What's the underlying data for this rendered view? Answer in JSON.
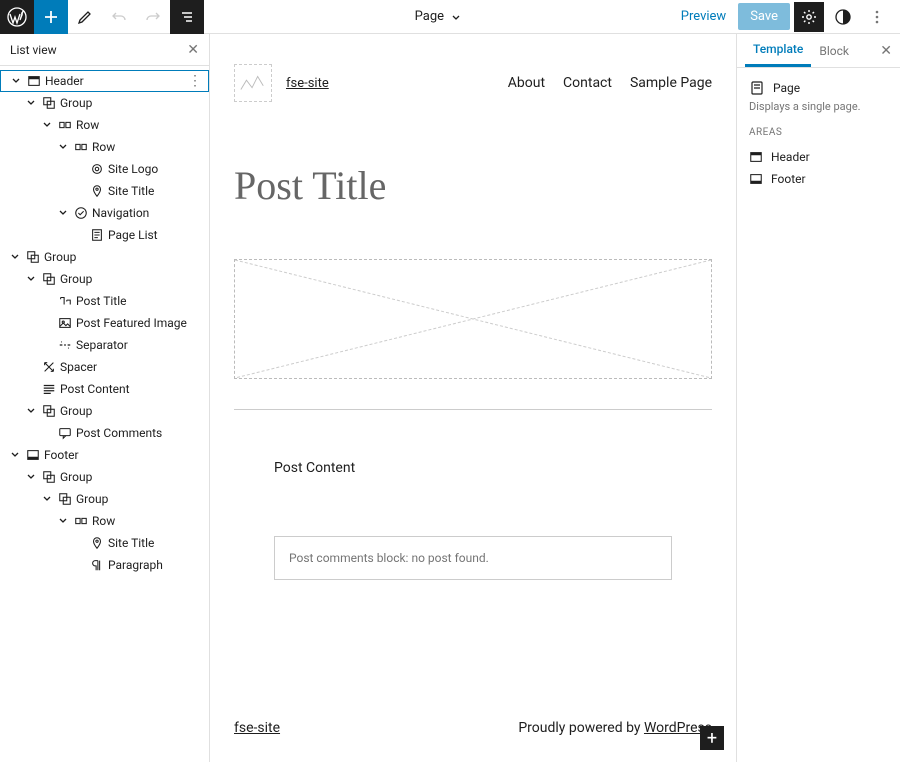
{
  "topbar": {
    "doc_type": "Page",
    "preview": "Preview",
    "save": "Save"
  },
  "listview": {
    "title": "List view",
    "items": [
      {
        "d": 0,
        "e": true,
        "ic": "header",
        "lbl": "Header",
        "sel": true,
        "more": true
      },
      {
        "d": 1,
        "e": true,
        "ic": "group",
        "lbl": "Group"
      },
      {
        "d": 2,
        "e": true,
        "ic": "row",
        "lbl": "Row"
      },
      {
        "d": 3,
        "e": true,
        "ic": "row",
        "lbl": "Row"
      },
      {
        "d": 4,
        "e": false,
        "ic": "logo",
        "lbl": "Site Logo"
      },
      {
        "d": 4,
        "e": false,
        "ic": "pin",
        "lbl": "Site Title"
      },
      {
        "d": 3,
        "e": true,
        "ic": "nav",
        "lbl": "Navigation"
      },
      {
        "d": 4,
        "e": false,
        "ic": "pagelist",
        "lbl": "Page List"
      },
      {
        "d": 0,
        "e": true,
        "ic": "group",
        "lbl": "Group"
      },
      {
        "d": 1,
        "e": true,
        "ic": "group",
        "lbl": "Group"
      },
      {
        "d": 2,
        "e": false,
        "ic": "posttitle",
        "lbl": "Post Title"
      },
      {
        "d": 2,
        "e": false,
        "ic": "featimg",
        "lbl": "Post Featured Image"
      },
      {
        "d": 2,
        "e": false,
        "ic": "separator",
        "lbl": "Separator"
      },
      {
        "d": 1,
        "e": false,
        "ic": "spacer",
        "lbl": "Spacer"
      },
      {
        "d": 1,
        "e": false,
        "ic": "postcontent",
        "lbl": "Post Content"
      },
      {
        "d": 1,
        "e": true,
        "ic": "group",
        "lbl": "Group"
      },
      {
        "d": 2,
        "e": false,
        "ic": "comments",
        "lbl": "Post Comments"
      },
      {
        "d": 0,
        "e": true,
        "ic": "footer",
        "lbl": "Footer"
      },
      {
        "d": 1,
        "e": true,
        "ic": "group",
        "lbl": "Group"
      },
      {
        "d": 2,
        "e": true,
        "ic": "group",
        "lbl": "Group"
      },
      {
        "d": 3,
        "e": true,
        "ic": "row",
        "lbl": "Row"
      },
      {
        "d": 4,
        "e": false,
        "ic": "pin",
        "lbl": "Site Title"
      },
      {
        "d": 4,
        "e": false,
        "ic": "paragraph",
        "lbl": "Paragraph"
      }
    ]
  },
  "canvas": {
    "site_title": "fse-site",
    "nav": [
      "About",
      "Contact",
      "Sample Page"
    ],
    "post_title": "Post Title",
    "post_content": "Post Content",
    "comments_msg": "Post comments block: no post found.",
    "footer_site": "fse-site",
    "footer_pre": "Proudly powered by ",
    "footer_link": "WordPress"
  },
  "inspector": {
    "tabs": [
      "Template",
      "Block"
    ],
    "page_label": "Page",
    "page_desc": "Displays a single page.",
    "areas_label": "Areas",
    "areas": [
      {
        "ic": "header",
        "lbl": "Header"
      },
      {
        "ic": "footer",
        "lbl": "Footer"
      }
    ]
  }
}
